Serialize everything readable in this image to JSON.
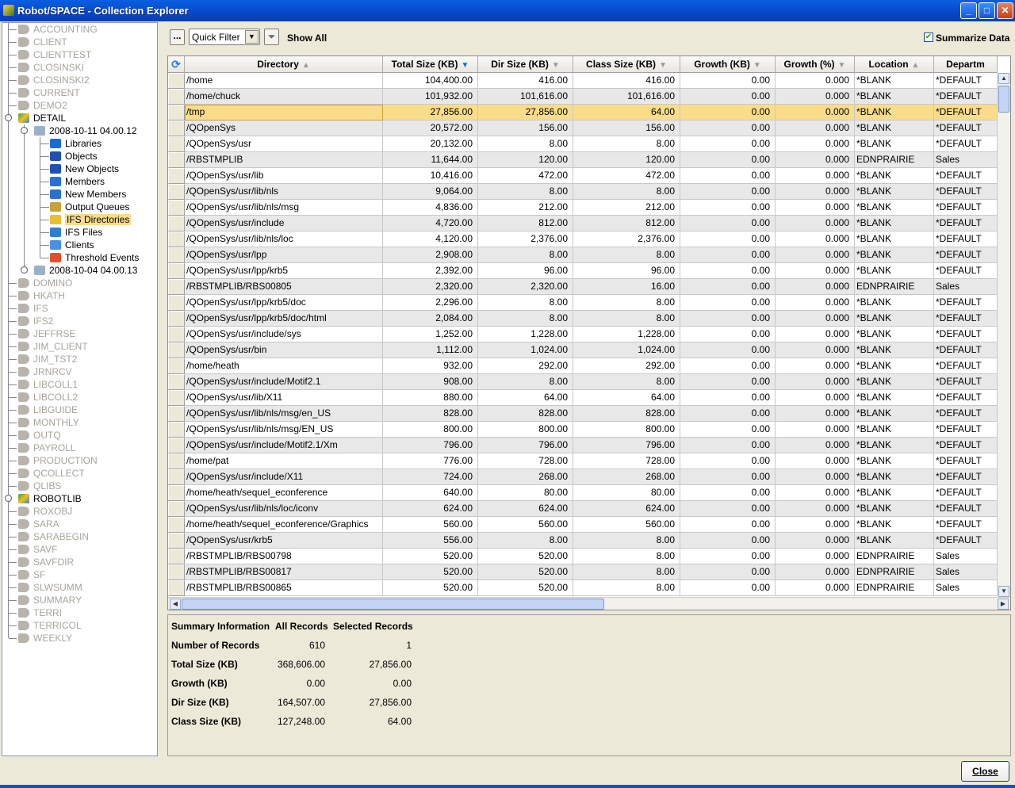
{
  "window": {
    "title": "Robot/SPACE - Collection Explorer",
    "minimize": "_",
    "maximize": "□",
    "close": "✕"
  },
  "tree": {
    "groups_before": [
      "ACCOUNTING",
      "CLIENT",
      "CLIENTTEST",
      "CLOSINSKI",
      "CLOSINSKI2",
      "CURRENT",
      "DEMO2"
    ],
    "detail": "DETAIL",
    "collection1": "2008-10-11  04.00.12",
    "children": [
      {
        "label": "Libraries",
        "icon": "libraries-icon",
        "color": "#1a6ad8"
      },
      {
        "label": "Objects",
        "icon": "objects-icon",
        "color": "#2050b0"
      },
      {
        "label": "New Objects",
        "icon": "new-objects-icon",
        "color": "#2050b0"
      },
      {
        "label": "Members",
        "icon": "members-icon",
        "color": "#2a70d0"
      },
      {
        "label": "New Members",
        "icon": "new-members-icon",
        "color": "#2a70d0"
      },
      {
        "label": "Output Queues",
        "icon": "output-queues-icon",
        "color": "#c8a040"
      },
      {
        "label": "IFS Directories",
        "icon": "ifs-directories-icon",
        "color": "#e8c030",
        "selected": true
      },
      {
        "label": "IFS Files",
        "icon": "ifs-files-icon",
        "color": "#3080d0"
      },
      {
        "label": "Clients",
        "icon": "clients-icon",
        "color": "#4a90e0"
      },
      {
        "label": "Threshold Events",
        "icon": "threshold-events-icon",
        "color": "#e05030"
      }
    ],
    "collection2": "2008-10-04  04.00.13",
    "groups_mid": [
      "DOMINO",
      "HKATH",
      "IFS",
      "IFS2",
      "JEFFRSE",
      "JIM_CLIENT",
      "JIM_TST2",
      "JRNRCV",
      "LIBCOLL1",
      "LIBCOLL2",
      "LIBGUIDE",
      "MONTHLY",
      "OUTQ",
      "PAYROLL",
      "PRODUCTION",
      "QCOLLECT",
      "QLIBS"
    ],
    "robotlib": "ROBOTLIB",
    "groups_after": [
      "ROXOBJ",
      "SARA",
      "SARABEGIN",
      "SAVF",
      "SAVFDIR",
      "SF",
      "SLWSUMM",
      "SUMMARY",
      "TERRI",
      "TERRICOL",
      "WEEKLY"
    ]
  },
  "toolbar": {
    "more_label": "...",
    "quick_filter": "Quick Filter",
    "show_all": "Show All",
    "summarize_label": "Summarize Data",
    "summarize_checked": true
  },
  "table": {
    "columns": [
      {
        "label": "Directory",
        "sort": "asc"
      },
      {
        "label": "Total Size (KB)",
        "sort": "desc-active"
      },
      {
        "label": "Dir Size (KB)",
        "sort": "desc"
      },
      {
        "label": "Class Size (KB)",
        "sort": "desc"
      },
      {
        "label": "Growth (KB)",
        "sort": "desc"
      },
      {
        "label": "Growth (%)",
        "sort": "desc"
      },
      {
        "label": "Location",
        "sort": "asc"
      },
      {
        "label": "Departm",
        "sort": ""
      }
    ],
    "selected_row": 2,
    "rows": [
      [
        "/home",
        "104,400.00",
        "416.00",
        "416.00",
        "0.00",
        "0.000",
        "*BLANK",
        "*DEFAULT"
      ],
      [
        "/home/chuck",
        "101,932.00",
        "101,616.00",
        "101,616.00",
        "0.00",
        "0.000",
        "*BLANK",
        "*DEFAULT"
      ],
      [
        "/tmp",
        "27,856.00",
        "27,856.00",
        "64.00",
        "0.00",
        "0.000",
        "*BLANK",
        "*DEFAULT"
      ],
      [
        "/QOpenSys",
        "20,572.00",
        "156.00",
        "156.00",
        "0.00",
        "0.000",
        "*BLANK",
        "*DEFAULT"
      ],
      [
        "/QOpenSys/usr",
        "20,132.00",
        "8.00",
        "8.00",
        "0.00",
        "0.000",
        "*BLANK",
        "*DEFAULT"
      ],
      [
        "/RBSTMPLIB",
        "11,644.00",
        "120.00",
        "120.00",
        "0.00",
        "0.000",
        "EDNPRAIRIE",
        "Sales"
      ],
      [
        "/QOpenSys/usr/lib",
        "10,416.00",
        "472.00",
        "472.00",
        "0.00",
        "0.000",
        "*BLANK",
        "*DEFAULT"
      ],
      [
        "/QOpenSys/usr/lib/nls",
        "9,064.00",
        "8.00",
        "8.00",
        "0.00",
        "0.000",
        "*BLANK",
        "*DEFAULT"
      ],
      [
        "/QOpenSys/usr/lib/nls/msg",
        "4,836.00",
        "212.00",
        "212.00",
        "0.00",
        "0.000",
        "*BLANK",
        "*DEFAULT"
      ],
      [
        "/QOpenSys/usr/include",
        "4,720.00",
        "812.00",
        "812.00",
        "0.00",
        "0.000",
        "*BLANK",
        "*DEFAULT"
      ],
      [
        "/QOpenSys/usr/lib/nls/loc",
        "4,120.00",
        "2,376.00",
        "2,376.00",
        "0.00",
        "0.000",
        "*BLANK",
        "*DEFAULT"
      ],
      [
        "/QOpenSys/usr/lpp",
        "2,908.00",
        "8.00",
        "8.00",
        "0.00",
        "0.000",
        "*BLANK",
        "*DEFAULT"
      ],
      [
        "/QOpenSys/usr/lpp/krb5",
        "2,392.00",
        "96.00",
        "96.00",
        "0.00",
        "0.000",
        "*BLANK",
        "*DEFAULT"
      ],
      [
        "/RBSTMPLIB/RBS00805",
        "2,320.00",
        "2,320.00",
        "16.00",
        "0.00",
        "0.000",
        "EDNPRAIRIE",
        "Sales"
      ],
      [
        "/QOpenSys/usr/lpp/krb5/doc",
        "2,296.00",
        "8.00",
        "8.00",
        "0.00",
        "0.000",
        "*BLANK",
        "*DEFAULT"
      ],
      [
        "/QOpenSys/usr/lpp/krb5/doc/html",
        "2,084.00",
        "8.00",
        "8.00",
        "0.00",
        "0.000",
        "*BLANK",
        "*DEFAULT"
      ],
      [
        "/QOpenSys/usr/include/sys",
        "1,252.00",
        "1,228.00",
        "1,228.00",
        "0.00",
        "0.000",
        "*BLANK",
        "*DEFAULT"
      ],
      [
        "/QOpenSys/usr/bin",
        "1,112.00",
        "1,024.00",
        "1,024.00",
        "0.00",
        "0.000",
        "*BLANK",
        "*DEFAULT"
      ],
      [
        "/home/heath",
        "932.00",
        "292.00",
        "292.00",
        "0.00",
        "0.000",
        "*BLANK",
        "*DEFAULT"
      ],
      [
        "/QOpenSys/usr/include/Motif2.1",
        "908.00",
        "8.00",
        "8.00",
        "0.00",
        "0.000",
        "*BLANK",
        "*DEFAULT"
      ],
      [
        "/QOpenSys/usr/lib/X11",
        "880.00",
        "64.00",
        "64.00",
        "0.00",
        "0.000",
        "*BLANK",
        "*DEFAULT"
      ],
      [
        "/QOpenSys/usr/lib/nls/msg/en_US",
        "828.00",
        "828.00",
        "828.00",
        "0.00",
        "0.000",
        "*BLANK",
        "*DEFAULT"
      ],
      [
        "/QOpenSys/usr/lib/nls/msg/EN_US",
        "800.00",
        "800.00",
        "800.00",
        "0.00",
        "0.000",
        "*BLANK",
        "*DEFAULT"
      ],
      [
        "/QOpenSys/usr/include/Motif2.1/Xm",
        "796.00",
        "796.00",
        "796.00",
        "0.00",
        "0.000",
        "*BLANK",
        "*DEFAULT"
      ],
      [
        "/home/pat",
        "776.00",
        "728.00",
        "728.00",
        "0.00",
        "0.000",
        "*BLANK",
        "*DEFAULT"
      ],
      [
        "/QOpenSys/usr/include/X11",
        "724.00",
        "268.00",
        "268.00",
        "0.00",
        "0.000",
        "*BLANK",
        "*DEFAULT"
      ],
      [
        "/home/heath/sequel_econference",
        "640.00",
        "80.00",
        "80.00",
        "0.00",
        "0.000",
        "*BLANK",
        "*DEFAULT"
      ],
      [
        "/QOpenSys/usr/lib/nls/loc/iconv",
        "624.00",
        "624.00",
        "624.00",
        "0.00",
        "0.000",
        "*BLANK",
        "*DEFAULT"
      ],
      [
        "/home/heath/sequel_econference/Graphics",
        "560.00",
        "560.00",
        "560.00",
        "0.00",
        "0.000",
        "*BLANK",
        "*DEFAULT"
      ],
      [
        "/QOpenSys/usr/krb5",
        "556.00",
        "8.00",
        "8.00",
        "0.00",
        "0.000",
        "*BLANK",
        "*DEFAULT"
      ],
      [
        "/RBSTMPLIB/RBS00798",
        "520.00",
        "520.00",
        "8.00",
        "0.00",
        "0.000",
        "EDNPRAIRIE",
        "Sales"
      ],
      [
        "/RBSTMPLIB/RBS00817",
        "520.00",
        "520.00",
        "8.00",
        "0.00",
        "0.000",
        "EDNPRAIRIE",
        "Sales"
      ],
      [
        "/RBSTMPLIB/RBS00865",
        "520.00",
        "520.00",
        "8.00",
        "0.00",
        "0.000",
        "EDNPRAIRIE",
        "Sales"
      ]
    ]
  },
  "summary": {
    "headers": [
      "Summary Information",
      "All Records",
      "Selected Records"
    ],
    "rows": [
      [
        "Number of Records",
        "610",
        "1"
      ],
      [
        "Total Size (KB)",
        "368,606.00",
        "27,856.00"
      ],
      [
        "Growth (KB)",
        "0.00",
        "0.00"
      ],
      [
        "Dir Size (KB)",
        "164,507.00",
        "27,856.00"
      ],
      [
        "Class Size (KB)",
        "127,248.00",
        "64.00"
      ]
    ]
  },
  "footer": {
    "close_label": "Close"
  },
  "colors": {
    "selection": "#fbdc8a",
    "title_bar": "#0a5fe0",
    "alt_row": "#e8e8e8"
  }
}
